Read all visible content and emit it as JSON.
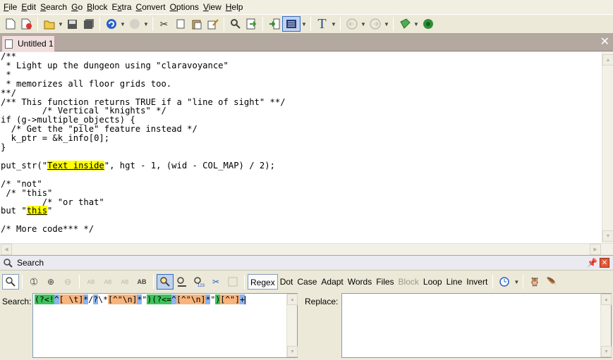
{
  "menu": [
    {
      "label": "File",
      "u": "F",
      "rest": "ile"
    },
    {
      "label": "Edit",
      "u": "E",
      "rest": "dit"
    },
    {
      "label": "Search",
      "u": "S",
      "rest": "earch"
    },
    {
      "label": "Go",
      "u": "G",
      "rest": "o"
    },
    {
      "label": "Block",
      "u": "B",
      "rest": "lock"
    },
    {
      "label": "Extra",
      "u": "x",
      "pre": "E",
      "rest": "tra"
    },
    {
      "label": "Convert",
      "u": "C",
      "rest": "onvert"
    },
    {
      "label": "Options",
      "u": "O",
      "rest": "ptions"
    },
    {
      "label": "View",
      "u": "V",
      "rest": "iew"
    },
    {
      "label": "Help",
      "u": "H",
      "rest": "elp"
    }
  ],
  "tab": {
    "label": "Untitled 1"
  },
  "editor": {
    "lines": [
      "/**",
      " * Light up the dungeon using \"claravoyance\"",
      " *",
      " * memorizes all floor grids too.",
      "**/",
      "/** This function returns TRUE if a \"line of sight\" **/",
      "        /* Vertical \"knights\" */",
      "if (g->multiple_objects) {",
      "  /* Get the \"pile\" feature instead */",
      "  k_ptr = &k_info[0];",
      "}",
      "",
      "put_str(\"",
      "",
      "/* \"not\"",
      " /* \"this\"",
      "        /* \"or that\"",
      "but \"",
      "",
      "/* More code*** */"
    ],
    "line12_pre": "put_str(\"",
    "line12_hl": "Text inside",
    "line12_post": "\", hgt - 1, (wid - COL_MAP) / 2);",
    "line17_pre": "but \"",
    "line17_hl": "this",
    "line17_post": "\""
  },
  "search_panel": {
    "title": "Search",
    "options": [
      "Regex",
      "Dot",
      "Case",
      "Adapt",
      "Words",
      "Files",
      "Block",
      "Loop",
      "Line",
      "Invert"
    ],
    "search_label": "Search:",
    "replace_label": "Replace:",
    "regex_parts": [
      {
        "t": "(?<!",
        "c": "rg"
      },
      {
        "t": "^",
        "c": "rb"
      },
      {
        "t": "[ \\t]",
        "c": "ro"
      },
      {
        "t": "*",
        "c": "rb"
      },
      {
        "t": "/",
        "c": ""
      },
      {
        "t": "?",
        "c": "rb"
      },
      {
        "t": "\\*",
        "c": ""
      },
      {
        "t": "[^\"\\n]",
        "c": "ro"
      },
      {
        "t": "*",
        "c": "rb"
      },
      {
        "t": "\"",
        "c": ""
      },
      {
        "t": ")",
        "c": "rg"
      },
      {
        "t": "(?<=",
        "c": "rg"
      },
      {
        "t": "^",
        "c": "rb"
      },
      {
        "t": "[^\"\\n]",
        "c": "ro"
      },
      {
        "t": "*",
        "c": "rb"
      },
      {
        "t": "\"",
        "c": ""
      },
      {
        "t": ")",
        "c": "rg"
      },
      {
        "t": "[^\"]",
        "c": "ro"
      },
      {
        "t": "+",
        "c": "rb"
      }
    ],
    "replace_value": ""
  },
  "colors": {
    "highlight": "#ffff00",
    "tab_bg": "#f0dede",
    "tabbar_bg": "#b4a9a1"
  }
}
